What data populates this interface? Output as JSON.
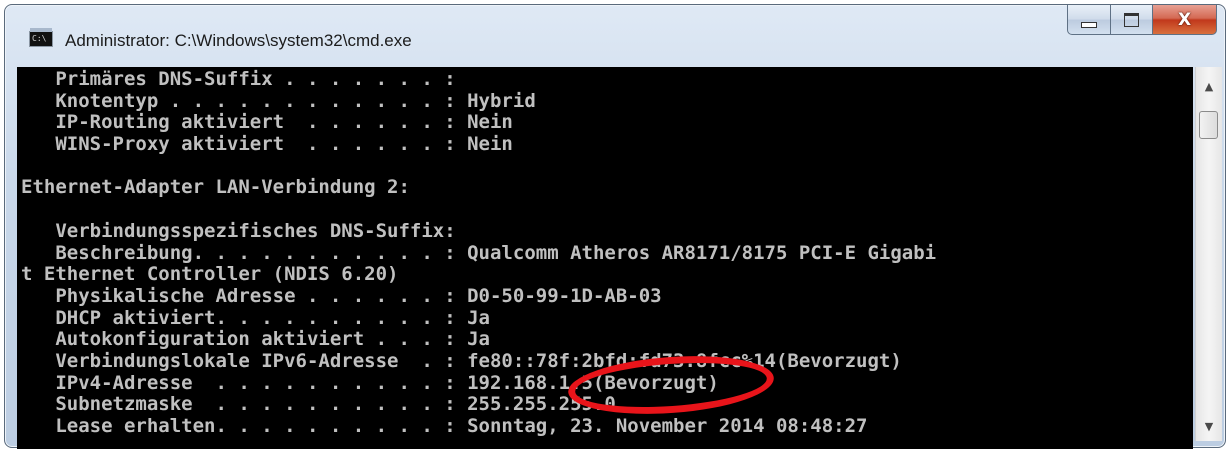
{
  "window": {
    "title": "Administrator: C:\\Windows\\system32\\cmd.exe",
    "icon": "cmd-console-icon",
    "icon_label": "C:\\",
    "caption_buttons": {
      "minimize": "minimize-icon",
      "maximize": "maximize-icon",
      "close": "close-icon",
      "close_glyph": "X"
    }
  },
  "console": {
    "background": "#000000",
    "foreground": "#c0c0c0",
    "lines": [
      "   Primäres DNS-Suffix . . . . . . . :",
      "   Knotentyp . . . . . . . . . . . . : Hybrid",
      "   IP-Routing aktiviert  . . . . . . : Nein",
      "   WINS-Proxy aktiviert  . . . . . . : Nein",
      "",
      "Ethernet-Adapter LAN-Verbindung 2:",
      "",
      "   Verbindungsspezifisches DNS-Suffix:",
      "   Beschreibung. . . . . . . . . . . : Qualcomm Atheros AR8171/8175 PCI-E Gigabi",
      "t Ethernet Controller (NDIS 6.20)",
      "   Physikalische Adresse . . . . . . : D0-50-99-1D-AB-03",
      "   DHCP aktiviert. . . . . . . . . . : Ja",
      "   Autokonfiguration aktiviert . . . : Ja",
      "   Verbindungslokale IPv6-Adresse  . : fe80::78f:2bfd:fd73:8fcc%14(Bevorzugt)",
      "   IPv4-Adresse  . . . . . . . . . . : 192.168.1.5(Bevorzugt)",
      "   Subnetzmaske  . . . . . . . . . . : 255.255.255.0",
      "   Lease erhalten. . . . . . . . . . : Sonntag, 23. November 2014 08:48:27"
    ]
  },
  "annotation": {
    "color": "#e8141a",
    "shape": "ellipse",
    "highlighted_value": "192.168.1.5"
  },
  "scrollbar": {
    "up": "scroll-up-arrow-icon",
    "down": "scroll-down-arrow-icon"
  }
}
